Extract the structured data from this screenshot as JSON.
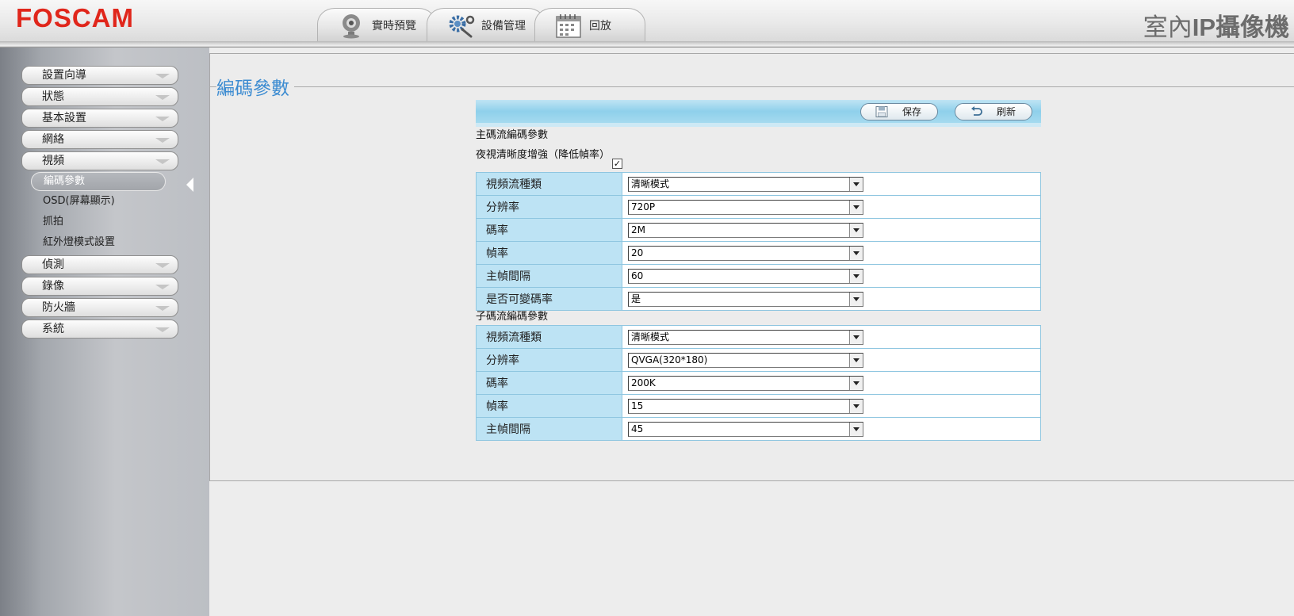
{
  "header": {
    "brand": "FOSCAM",
    "product_title_regular": "室內",
    "product_title_bold": "IP",
    "product_title_rest": "攝像機",
    "tabs": [
      {
        "label": "實時預覽",
        "icon": "webcam-icon"
      },
      {
        "label": "設備管理",
        "icon": "gear-wrench-icon"
      },
      {
        "label": "回放",
        "icon": "calendar-icon"
      }
    ]
  },
  "sidebar": {
    "menu": [
      {
        "label": "設置向導"
      },
      {
        "label": "狀態"
      },
      {
        "label": "基本設置"
      },
      {
        "label": "網絡"
      },
      {
        "label": "視頻"
      },
      {
        "label": "偵測"
      },
      {
        "label": "錄像"
      },
      {
        "label": "防火牆"
      },
      {
        "label": "系統"
      }
    ],
    "video_submenu": [
      {
        "label": "編碼參數",
        "active": true
      },
      {
        "label": "OSD(屏幕顯示)"
      },
      {
        "label": "抓拍"
      },
      {
        "label": "紅外燈模式設置"
      }
    ]
  },
  "main": {
    "section_title": "編碼參數",
    "toolbar": {
      "save_label": "保存",
      "refresh_label": "刷新"
    },
    "main_stream": {
      "heading": "主碼流編碼參數",
      "night_vision_label": "夜視清晰度增強（降低幀率）",
      "night_vision_checked": true,
      "rows": [
        {
          "label": "視頻流種類",
          "value": "清晰模式"
        },
        {
          "label": "分辨率",
          "value": "720P"
        },
        {
          "label": "碼率",
          "value": "2M"
        },
        {
          "label": "幀率",
          "value": "20"
        },
        {
          "label": "主幀間隔",
          "value": "60"
        },
        {
          "label": "是否可變碼率",
          "value": "是"
        }
      ]
    },
    "sub_stream": {
      "heading": "子碼流編碼參數",
      "rows": [
        {
          "label": "視頻流種類",
          "value": "清晰模式"
        },
        {
          "label": "分辨率",
          "value": "QVGA(320*180)"
        },
        {
          "label": "碼率",
          "value": "200K"
        },
        {
          "label": "幀率",
          "value": "15"
        },
        {
          "label": "主幀間隔",
          "value": "45"
        }
      ]
    }
  },
  "colors": {
    "brand_red": "#e0261b",
    "title_blue": "#3b8bd1",
    "label_cell_blue": "#bde3f4",
    "toolbar_blue": "#8fd0eb"
  }
}
